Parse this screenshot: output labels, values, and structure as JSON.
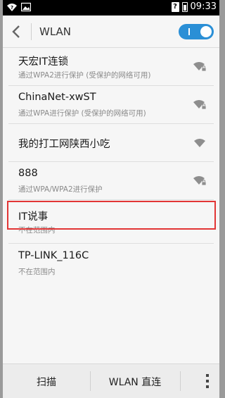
{
  "status_bar": {
    "time": "09:33",
    "left_icons": [
      "wifi-question-icon",
      "image-icon"
    ],
    "right_icons": [
      "sim-question-icon",
      "battery-icon"
    ]
  },
  "action_bar": {
    "title": "WLAN",
    "wlan_toggle": "on"
  },
  "networks": [
    {
      "ssid": "天宏IT连锁",
      "status": "通过WPA2进行保护 (受保护的网络可用)",
      "secured": true
    },
    {
      "ssid": "ChinaNet-xwST",
      "status": "通过WPA进行保护 (受保护的网络可用)",
      "secured": true
    },
    {
      "ssid": "我的打工网陕西小吃",
      "status": "",
      "secured": false
    },
    {
      "ssid": "888",
      "status": "通过WPA/WPA2进行保护",
      "secured": true
    },
    {
      "ssid": "IT说事",
      "status": "不在范围内",
      "secured": false
    },
    {
      "ssid": "TP-LINK_116C",
      "status": "不在范围内",
      "secured": false
    }
  ],
  "bottom_bar": {
    "scan_label": "扫描",
    "direct_label": "WLAN 直连"
  },
  "colors": {
    "accent": "#2a8fd6",
    "highlight": "#e23535"
  }
}
